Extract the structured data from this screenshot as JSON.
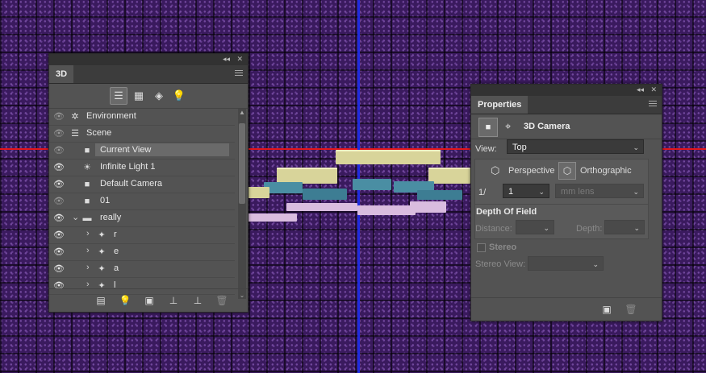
{
  "panel3d": {
    "tab_label": "3D",
    "filter_icons": [
      "scene-filter-icon",
      "mesh-filter-icon",
      "material-filter-icon",
      "light-filter-icon"
    ],
    "rows": [
      {
        "label": "Environment",
        "icon": "environment-icon",
        "visible": false
      },
      {
        "label": "Scene",
        "icon": "scene-icon",
        "visible": false
      },
      {
        "label": "Current View",
        "icon": "camera-icon",
        "visible": false
      },
      {
        "label": "Infinite Light 1",
        "icon": "light-icon",
        "visible": true
      },
      {
        "label": "Default Camera",
        "icon": "camera-icon",
        "visible": true
      },
      {
        "label": "01",
        "icon": "camera-icon",
        "visible": false
      },
      {
        "label": "really",
        "icon": "folder-icon",
        "visible": true
      },
      {
        "label": "r",
        "icon": "mesh-icon",
        "visible": true
      },
      {
        "label": "e",
        "icon": "mesh-icon",
        "visible": true
      },
      {
        "label": "a",
        "icon": "mesh-icon",
        "visible": true
      },
      {
        "label": "l",
        "icon": "mesh-icon",
        "visible": true
      }
    ],
    "bottom_icons": [
      "add-object-icon",
      "add-light-icon",
      "render-icon",
      "ground-icon",
      "drop-to-plane-icon",
      "trash-icon"
    ]
  },
  "properties": {
    "tab_label": "Properties",
    "title": "3D Camera",
    "view_label": "View:",
    "view_value": "Top",
    "perspective_label": "Perspective",
    "orthographic_label": "Orthographic",
    "ratio_label": "1/",
    "ratio_value": "1",
    "lens_value": "mm lens",
    "dof_title": "Depth Of Field",
    "distance_label": "Distance:",
    "depth_label": "Depth:",
    "stereo_label": "Stereo",
    "stereo_view_label": "Stereo View:"
  },
  "colors": {
    "axis_x": "#e3151b",
    "axis_y": "#1e2ce0",
    "extrude_yellow": "#d8d49a",
    "extrude_teal": "#4a8ea3",
    "extrude_pink": "#d9bcdf"
  }
}
